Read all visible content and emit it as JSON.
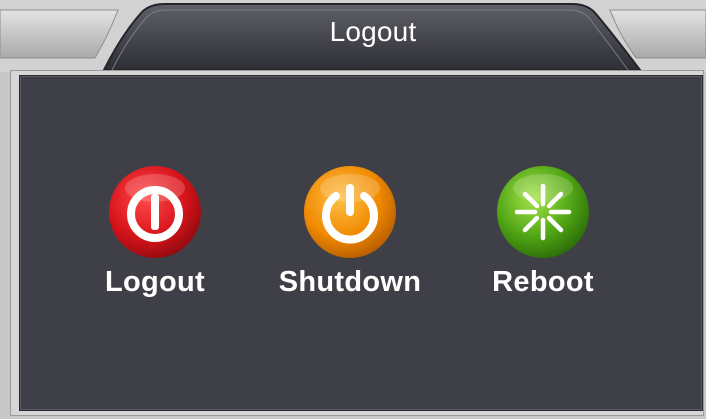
{
  "window": {
    "title": "Logout"
  },
  "actions": [
    {
      "id": "logout",
      "label": "Logout",
      "icon": "power-icon",
      "color": "#d8141b"
    },
    {
      "id": "shutdown",
      "label": "Shutdown",
      "icon": "power-icon",
      "color": "#f08a00"
    },
    {
      "id": "reboot",
      "label": "Reboot",
      "icon": "asterisk-icon",
      "color": "#4fa414"
    }
  ]
}
